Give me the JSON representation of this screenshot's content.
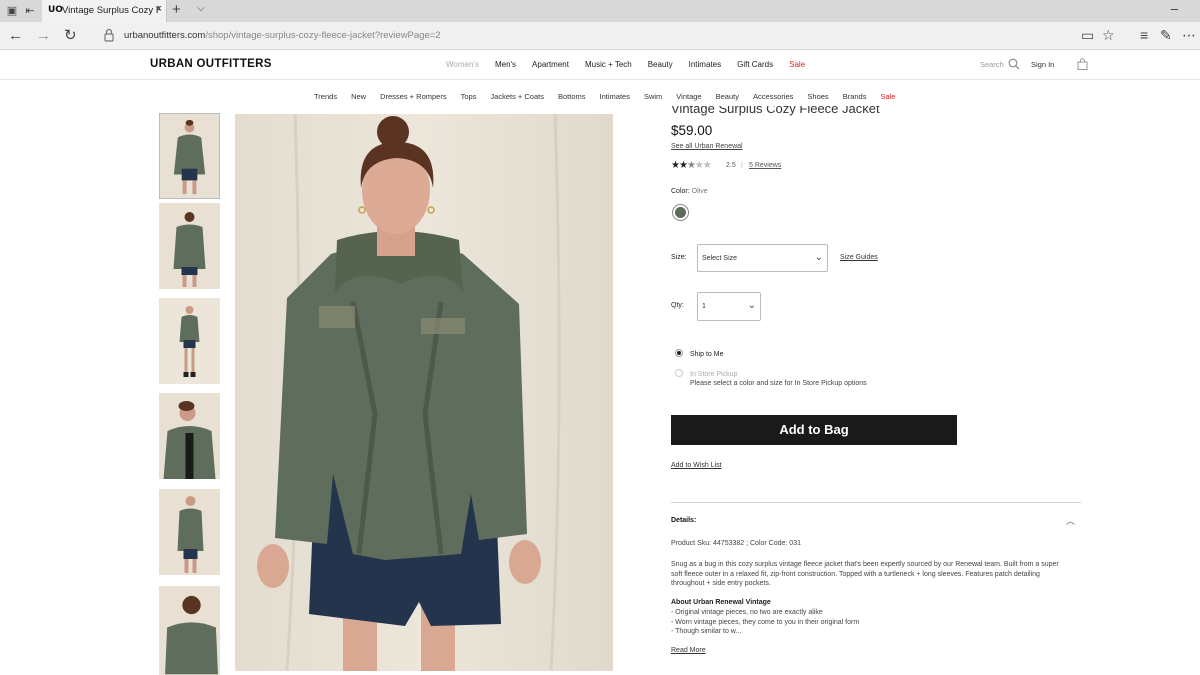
{
  "browser": {
    "tab_title": "Vintage Surplus Cozy Fl",
    "tab_favicon": "UO",
    "url_host": "urbanoutfitters.com",
    "url_path": "/shop/vintage-surplus-cozy-fleece-jacket?reviewPage=2",
    "icons": [
      "tab-preview-icon",
      "tabs-aside-icon",
      "back-icon",
      "forward-icon",
      "refresh-icon",
      "lock-icon",
      "reading-view-icon",
      "favorite-star-icon",
      "hub-icon",
      "web-note-icon",
      "more-icon",
      "minimize-icon"
    ]
  },
  "header": {
    "logo": "URBAN OUTFITTERS",
    "nav": [
      {
        "label": "Women's",
        "muted": true
      },
      {
        "label": "Men's"
      },
      {
        "label": "Apartment"
      },
      {
        "label": "Music + Tech"
      },
      {
        "label": "Beauty"
      },
      {
        "label": "Intimates"
      },
      {
        "label": "Gift Cards"
      },
      {
        "label": "Sale",
        "sale": true
      }
    ],
    "search_label": "Search",
    "signin_label": "Sign In"
  },
  "subnav": [
    "Trends",
    "New",
    "Dresses + Rompers",
    "Tops",
    "Jackets + Coats",
    "Bottoms",
    "Intimates",
    "Swim",
    "Vintage",
    "Beauty",
    "Accessories",
    "Shoes",
    "Brands",
    "Sale"
  ],
  "product": {
    "title": "Vintage Surplus Cozy Fleece Jacket",
    "price": "$59.00",
    "see_all": "See all Urban Renewal",
    "rating_value": 2.5,
    "rating_text": "2.5",
    "rating_sep": "|",
    "reviews": "5 Reviews",
    "color_label": "Color:",
    "color_value": "Olive",
    "swatch_color": "#5d6b5a",
    "size_label": "Size:",
    "size_placeholder": "Select Size",
    "size_guides": "Size Guides",
    "qty_label": "Qty:",
    "qty_value": "1",
    "ship_to_me": "Ship to Me",
    "in_store": "In Store Pickup",
    "in_store_note": "Please select a color and size for In Store Pickup options",
    "add_to_bag": "Add to Bag",
    "add_to_wishlist": "Add to Wish List",
    "details_header": "Details:",
    "sku_line": "Product Sku: 44753382 ; Color Code: 031",
    "description": "Snug as a bug in this cozy surplus vintage fleece jacket that's been expertly sourced by our Renewal team. Built from a super soft fleece outer in a relaxed fit, zip-front construction. Topped with a turtleneck + long sleeves. Features patch detailing throughout + side entry pockets.",
    "about_header": "About Urban Renewal Vintage",
    "about_bullets": [
      "- Original vintage pieces, no two are exactly alike",
      "- Worn vintage pieces, they come to you in their original form",
      "- Though similar to w..."
    ],
    "read_more": "Read More"
  },
  "colors": {
    "sale": "#e02020",
    "button_bg": "#1a1a1a",
    "jacket": "#5f6e5c",
    "skirt": "#24344d",
    "backdrop": "#e6e0d3"
  }
}
